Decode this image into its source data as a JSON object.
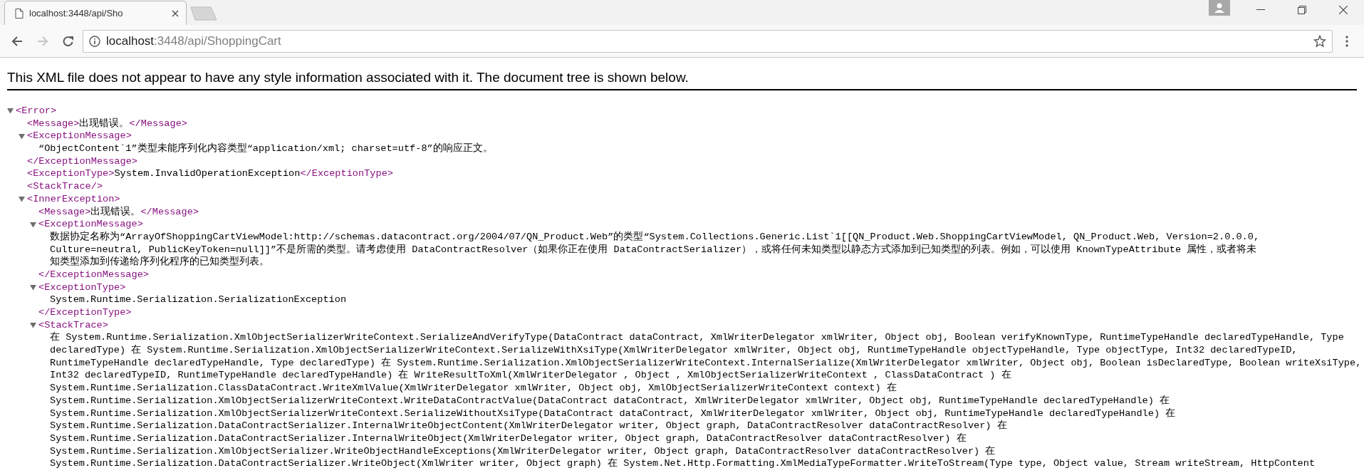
{
  "browser": {
    "tab": {
      "title": "localhost:3448/api/Sho",
      "selected": true
    },
    "nav": {
      "back": {
        "disabled": false
      },
      "forward": {
        "disabled": true
      }
    },
    "address": {
      "host": "localhost",
      "path": ":3448/api/ShoppingCart"
    }
  },
  "notice": "This XML file does not appear to have any style information associated with it. The document tree is shown below.",
  "tree": [
    {
      "kind": "parent",
      "open": "<Error>",
      "expanded": true,
      "children": [
        {
          "kind": "inline",
          "open": "<Message>",
          "text": "出现错误。",
          "close": "</Message>"
        },
        {
          "kind": "block",
          "open": "<ExceptionMessage>",
          "expanded": true,
          "lines": [
            "“ObjectContent`1”类型未能序列化内容类型“application/xml; charset=utf-8”的响应正文。"
          ],
          "close": "</ExceptionMessage>"
        },
        {
          "kind": "inline",
          "open": "<ExceptionType>",
          "text": "System.InvalidOperationException",
          "close": "</ExceptionType>"
        },
        {
          "kind": "empty",
          "open": "<StackTrace/>"
        },
        {
          "kind": "parent",
          "open": "<InnerException>",
          "expanded": true,
          "children": [
            {
              "kind": "inline",
              "open": "<Message>",
              "text": "出现错误。",
              "close": "</Message>"
            },
            {
              "kind": "block",
              "open": "<ExceptionMessage>",
              "expanded": true,
              "lines": [
                "数据协定名称为“ArrayOfShoppingCartViewModel:http://schemas.datacontract.org/2004/07/QN_Product.Web”的类型“System.Collections.Generic.List`1[[QN_Product.Web.ShoppingCartViewModel, QN_Product.Web, Version=2.0.0.0,",
                "Culture=neutral, PublicKeyToken=null]]”不是所需的类型。请考虑使用 DataContractResolver（如果你正在使用 DataContractSerializer），或将任何未知类型以静态方式添加到已知类型的列表。例如，可以使用 KnownTypeAttribute 属性，或者将未",
                "知类型添加到传递给序列化程序的已知类型列表。"
              ],
              "close": "</ExceptionMessage>"
            },
            {
              "kind": "block",
              "open": "<ExceptionType>",
              "expanded": true,
              "lines": [
                "System.Runtime.Serialization.SerializationException"
              ],
              "close": "</ExceptionType>"
            },
            {
              "kind": "block",
              "open": "<StackTrace>",
              "expanded": true,
              "lines": [
                "在 System.Runtime.Serialization.XmlObjectSerializerWriteContext.SerializeAndVerifyType(DataContract dataContract, XmlWriterDelegator xmlWriter, Object obj, Boolean verifyKnownType, RuntimeTypeHandle declaredTypeHandle, Type",
                "declaredType) 在 System.Runtime.Serialization.XmlObjectSerializerWriteContext.SerializeWithXsiType(XmlWriterDelegator xmlWriter, Object obj, RuntimeTypeHandle objectTypeHandle, Type objectType, Int32 declaredTypeID,",
                "RuntimeTypeHandle declaredTypeHandle, Type declaredType) 在 System.Runtime.Serialization.XmlObjectSerializerWriteContext.InternalSerialize(XmlWriterDelegator xmlWriter, Object obj, Boolean isDeclaredType, Boolean writeXsiType,",
                "Int32 declaredTypeID, RuntimeTypeHandle declaredTypeHandle) 在 WriteResultToXml(XmlWriterDelegator , Object , XmlObjectSerializerWriteContext , ClassDataContract ) 在",
                "System.Runtime.Serialization.ClassDataContract.WriteXmlValue(XmlWriterDelegator xmlWriter, Object obj, XmlObjectSerializerWriteContext context) 在",
                "System.Runtime.Serialization.XmlObjectSerializerWriteContext.WriteDataContractValue(DataContract dataContract, XmlWriterDelegator xmlWriter, Object obj, RuntimeTypeHandle declaredTypeHandle) 在",
                "System.Runtime.Serialization.XmlObjectSerializerWriteContext.SerializeWithoutXsiType(DataContract dataContract, XmlWriterDelegator xmlWriter, Object obj, RuntimeTypeHandle declaredTypeHandle) 在",
                "System.Runtime.Serialization.DataContractSerializer.InternalWriteObjectContent(XmlWriterDelegator writer, Object graph, DataContractResolver dataContractResolver) 在",
                "System.Runtime.Serialization.DataContractSerializer.InternalWriteObject(XmlWriterDelegator writer, Object graph, DataContractResolver dataContractResolver) 在",
                "System.Runtime.Serialization.XmlObjectSerializer.WriteObjectHandleExceptions(XmlWriterDelegator writer, Object graph, DataContractResolver dataContractResolver) 在",
                "System.Runtime.Serialization.DataContractSerializer.WriteObject(XmlWriter writer, Object graph) 在 System.Net.Http.Formatting.XmlMediaTypeFormatter.WriteToStream(Type type, Object value, Stream writeStream, HttpContent"
              ]
            }
          ]
        }
      ]
    }
  ]
}
